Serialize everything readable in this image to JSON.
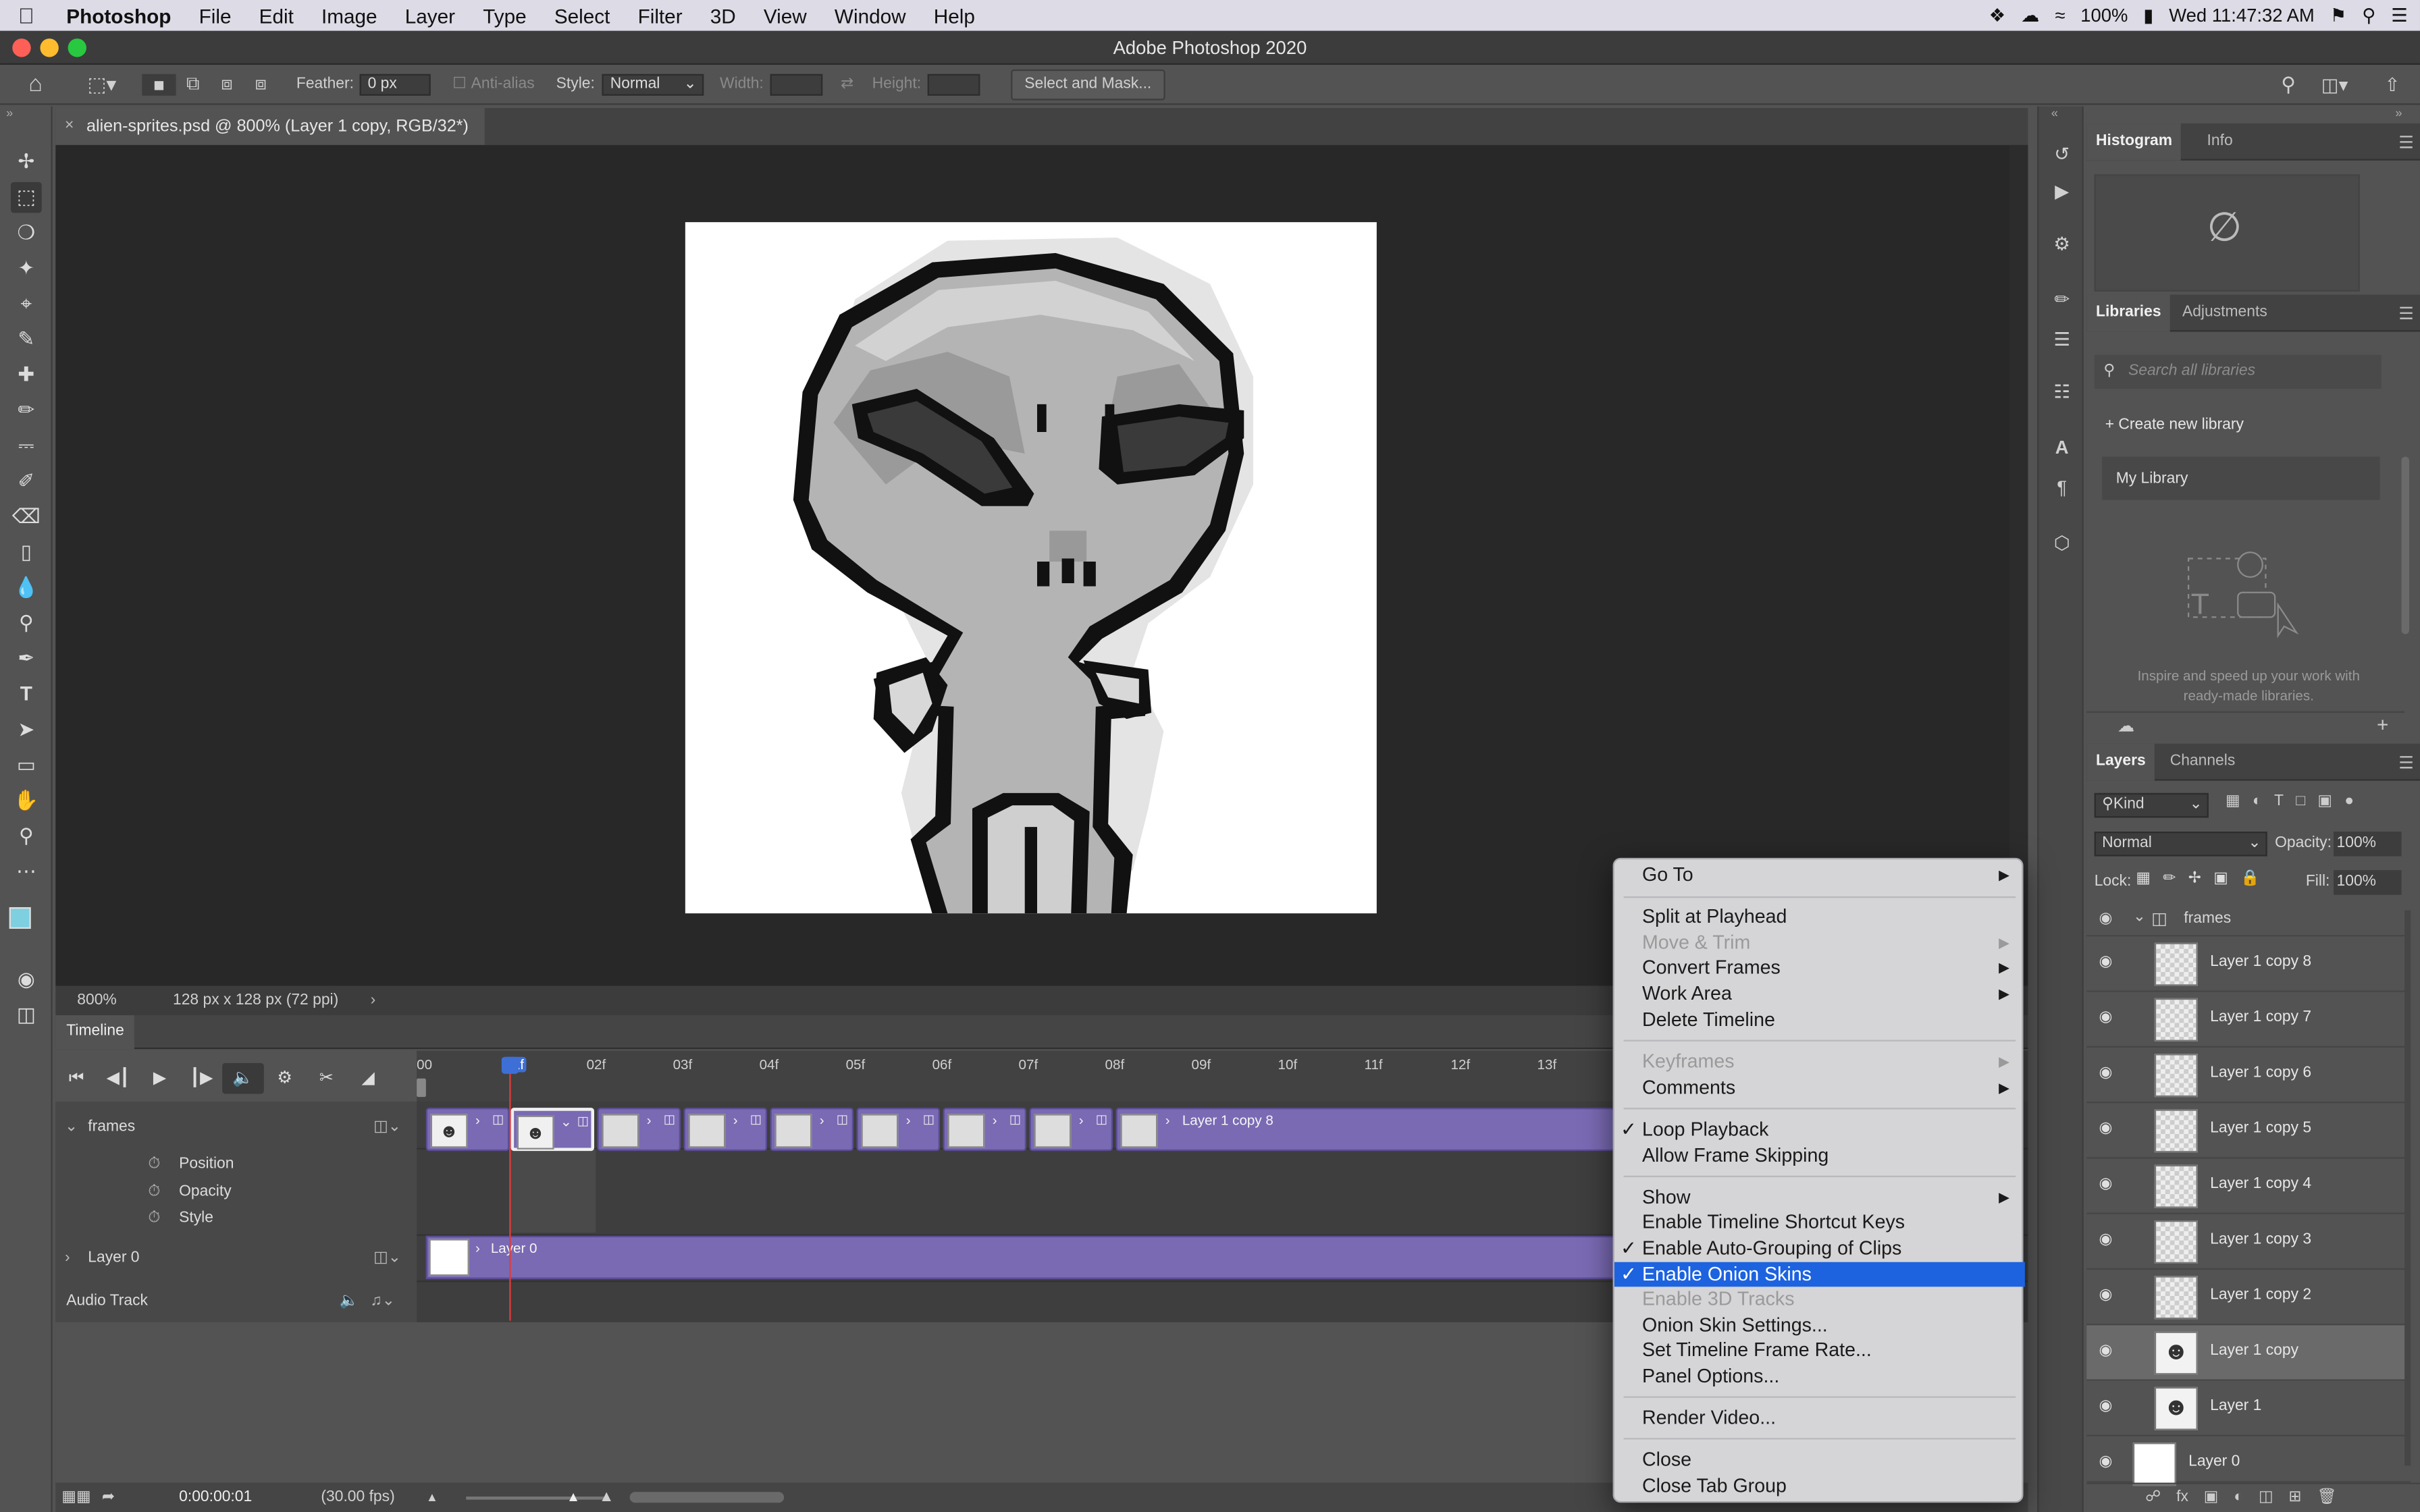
{
  "menubar": {
    "app_name": "Photoshop",
    "items": [
      "File",
      "Edit",
      "Image",
      "Layer",
      "Type",
      "Select",
      "Filter",
      "3D",
      "View",
      "Window",
      "Help"
    ],
    "battery": "100%",
    "clock": "Wed 11:47:32 AM"
  },
  "window": {
    "title": "Adobe Photoshop 2020"
  },
  "options": {
    "feather_label": "Feather:",
    "feather_value": "0 px",
    "antialias_label": "Anti-alias",
    "style_label": "Style:",
    "style_value": "Normal",
    "width_label": "Width:",
    "height_label": "Height:",
    "select_mask_label": "Select and Mask..."
  },
  "document": {
    "tab_title": "alien-sprites.psd @ 800% (Layer 1 copy, RGB/32*)",
    "zoom": "800%",
    "doc_info": "128 px x 128 px (72 ppi)"
  },
  "timeline": {
    "tab": "Timeline",
    "ruler_ticks": [
      "00",
      "01f",
      "02f",
      "03f",
      "04f",
      "05f",
      "06f",
      "07f",
      "08f",
      "09f",
      "10f",
      "11f",
      "12f",
      "13f"
    ],
    "group_name": "frames",
    "properties": [
      "Position",
      "Opacity",
      "Style"
    ],
    "last_clip_label": "Layer 1 copy 8",
    "layer0_track": "Layer 0",
    "layer0_clip": "Layer 0",
    "audio_track": "Audio Track",
    "timecode": "0:00:00:01",
    "fps": "(30.00 fps)"
  },
  "panels": {
    "top_tabs": [
      "Histogram",
      "Info"
    ],
    "lib_tabs": [
      "Libraries",
      "Adjustments"
    ],
    "lib_search_placeholder": "Search all libraries",
    "create_library": "Create new library",
    "my_library": "My Library",
    "lib_note_line1": "Inspire and speed up your work with",
    "lib_note_line2": "ready-made libraries.",
    "layer_tabs": [
      "Layers",
      "Channels"
    ],
    "kind_label": "Kind",
    "blend_mode": "Normal",
    "opacity_label": "Opacity:",
    "opacity_value": "100%",
    "lock_label": "Lock:",
    "fill_label": "Fill:",
    "fill_value": "100%",
    "group": "frames",
    "layers": [
      "Layer 1 copy 8",
      "Layer 1 copy 7",
      "Layer 1 copy 6",
      "Layer 1 copy 5",
      "Layer 1 copy 4",
      "Layer 1 copy 3",
      "Layer 1 copy 2",
      "Layer 1 copy",
      "Layer 1",
      "Layer 0"
    ]
  },
  "context_menu": {
    "go_to": "Go To",
    "split": "Split at Playhead",
    "move_trim": "Move & Trim",
    "convert": "Convert Frames",
    "work_area": "Work Area",
    "delete_timeline": "Delete Timeline",
    "keyframes": "Keyframes",
    "comments": "Comments",
    "loop": "Loop Playback",
    "skip": "Allow Frame Skipping",
    "show": "Show",
    "shortcut": "Enable Timeline Shortcut Keys",
    "autogroup": "Enable Auto-Grouping of Clips",
    "onion": "Enable Onion Skins",
    "tracks3d": "Enable 3D Tracks",
    "onion_settings": "Onion Skin Settings...",
    "frame_rate": "Set Timeline Frame Rate...",
    "panel_options": "Panel Options...",
    "render": "Render Video...",
    "close": "Close",
    "close_group": "Close Tab Group"
  },
  "colors": {
    "accent": "#1d63e0",
    "clip": "#7a6ab4",
    "playhead": "#e23b3b"
  }
}
